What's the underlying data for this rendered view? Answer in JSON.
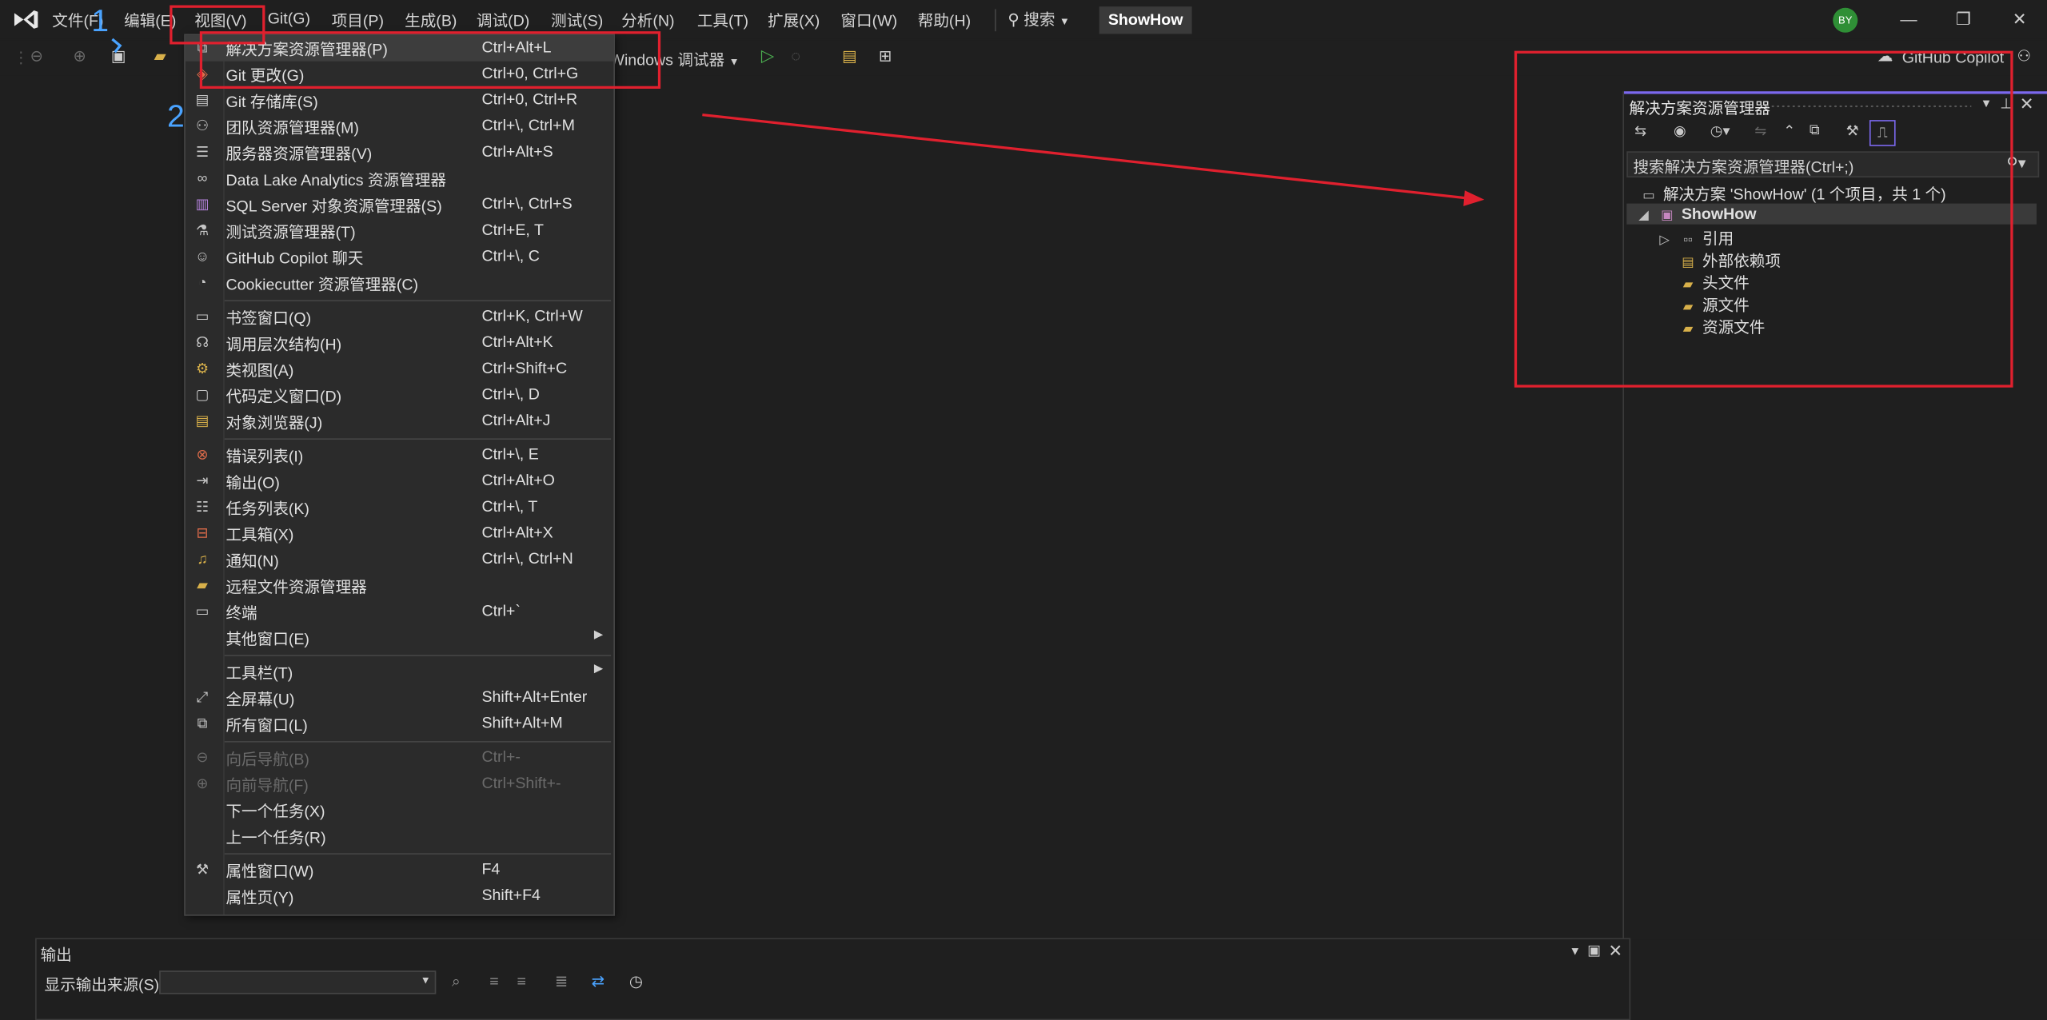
{
  "menubar": {
    "items": [
      "文件(F)",
      "编辑(E)",
      "视图(V)",
      "Git(G)",
      "项目(P)",
      "生成(B)",
      "调试(D)",
      "测试(S)",
      "分析(N)",
      "工具(T)",
      "扩展(X)",
      "窗口(W)",
      "帮助(H)"
    ],
    "search_label": "搜索",
    "solution_name": "ShowHow",
    "avatar_initials": "BY"
  },
  "toolbar": {
    "debug_target": "Windows 调试器",
    "copilot_label": "GitHub Copilot"
  },
  "annotations": {
    "step1": "1",
    "step2": "2",
    "color": "#e0202e"
  },
  "view_menu": {
    "items": [
      {
        "label": "解决方案资源管理器(P)",
        "shortcut": "Ctrl+Alt+L",
        "icon": "solution-explorer-icon"
      },
      {
        "label": "Git 更改(G)",
        "shortcut": "Ctrl+0, Ctrl+G",
        "icon": "git-changes-icon"
      },
      {
        "label": "Git 存储库(S)",
        "shortcut": "Ctrl+0, Ctrl+R",
        "icon": "git-repo-icon"
      },
      {
        "label": "团队资源管理器(M)",
        "shortcut": "Ctrl+\\, Ctrl+M",
        "icon": "team-explorer-icon"
      },
      {
        "label": "服务器资源管理器(V)",
        "shortcut": "Ctrl+Alt+S",
        "icon": "server-explorer-icon"
      },
      {
        "label": "Data Lake Analytics 资源管理器",
        "shortcut": "",
        "icon": "data-lake-icon"
      },
      {
        "label": "SQL Server 对象资源管理器(S)",
        "shortcut": "Ctrl+\\, Ctrl+S",
        "icon": "sql-server-icon"
      },
      {
        "label": "测试资源管理器(T)",
        "shortcut": "Ctrl+E, T",
        "icon": "test-explorer-icon"
      },
      {
        "label": "GitHub Copilot 聊天",
        "shortcut": "Ctrl+\\, C",
        "icon": "copilot-icon"
      },
      {
        "label": "Cookiecutter 资源管理器(C)",
        "shortcut": "",
        "icon": "cookiecutter-icon"
      },
      {
        "label": "书签窗口(Q)",
        "shortcut": "Ctrl+K, Ctrl+W",
        "icon": "bookmark-icon"
      },
      {
        "label": "调用层次结构(H)",
        "shortcut": "Ctrl+Alt+K",
        "icon": "call-hierarchy-icon"
      },
      {
        "label": "类视图(A)",
        "shortcut": "Ctrl+Shift+C",
        "icon": "class-view-icon"
      },
      {
        "label": "代码定义窗口(D)",
        "shortcut": "Ctrl+\\, D",
        "icon": "code-definition-icon"
      },
      {
        "label": "对象浏览器(J)",
        "shortcut": "Ctrl+Alt+J",
        "icon": "object-browser-icon"
      },
      {
        "label": "错误列表(I)",
        "shortcut": "Ctrl+\\, E",
        "icon": "error-list-icon"
      },
      {
        "label": "输出(O)",
        "shortcut": "Ctrl+Alt+O",
        "icon": "output-icon"
      },
      {
        "label": "任务列表(K)",
        "shortcut": "Ctrl+\\, T",
        "icon": "task-list-icon"
      },
      {
        "label": "工具箱(X)",
        "shortcut": "Ctrl+Alt+X",
        "icon": "toolbox-icon"
      },
      {
        "label": "通知(N)",
        "shortcut": "Ctrl+\\, Ctrl+N",
        "icon": "bell-icon"
      },
      {
        "label": "远程文件资源管理器",
        "shortcut": "",
        "icon": "remote-files-icon"
      },
      {
        "label": "终端",
        "shortcut": "Ctrl+`",
        "icon": "terminal-icon"
      },
      {
        "label": "其他窗口(E)",
        "shortcut": "",
        "icon": ""
      },
      {
        "label": "工具栏(T)",
        "shortcut": "",
        "icon": ""
      },
      {
        "label": "全屏幕(U)",
        "shortcut": "Shift+Alt+Enter",
        "icon": "fullscreen-icon"
      },
      {
        "label": "所有窗口(L)",
        "shortcut": "Shift+Alt+M",
        "icon": "all-windows-icon"
      },
      {
        "label": "向后导航(B)",
        "shortcut": "Ctrl+-",
        "icon": "nav-back-icon"
      },
      {
        "label": "向前导航(F)",
        "shortcut": "Ctrl+Shift+-",
        "icon": "nav-forward-icon"
      },
      {
        "label": "下一个任务(X)",
        "shortcut": "",
        "icon": ""
      },
      {
        "label": "上一个任务(R)",
        "shortcut": "",
        "icon": ""
      },
      {
        "label": "属性窗口(W)",
        "shortcut": "F4",
        "icon": "wrench-icon"
      },
      {
        "label": "属性页(Y)",
        "shortcut": "Shift+F4",
        "icon": ""
      }
    ]
  },
  "solution_explorer": {
    "title": "解决方案资源管理器",
    "search_placeholder": "搜索解决方案资源管理器(Ctrl+;)",
    "solution_node": "解决方案 'ShowHow' (1 个项目，共 1 个)",
    "project_node": "ShowHow",
    "children": [
      "引用",
      "外部依赖项",
      "头文件",
      "源文件",
      "资源文件"
    ]
  },
  "output": {
    "title": "输出",
    "source_label": "显示输出来源(S):",
    "source_value": ""
  }
}
